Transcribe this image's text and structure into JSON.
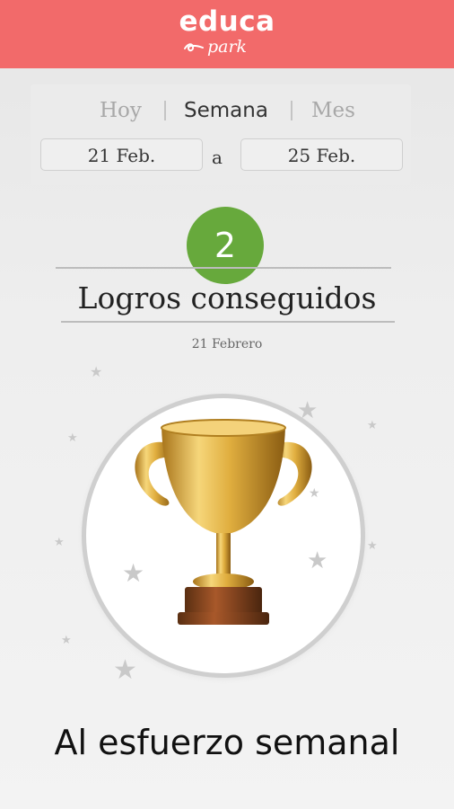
{
  "header": {
    "logo_main": "educa",
    "logo_sub": "park"
  },
  "period_tabs": [
    {
      "label": "Hoy",
      "active": false
    },
    {
      "label": "Semana",
      "active": true
    },
    {
      "label": "Mes",
      "active": false
    }
  ],
  "date_range": {
    "from": "21 Feb.",
    "connector": "a",
    "to": "25 Feb."
  },
  "summary": {
    "count": "2",
    "title": "Logros conseguidos",
    "date": "21 Febrero"
  },
  "achievement": {
    "icon": "trophy-icon",
    "caption": "Al esfuerzo semanal"
  },
  "colors": {
    "header": "#f26a6a",
    "badge": "#67a93c",
    "trophy_gold": "#d9a73a"
  }
}
